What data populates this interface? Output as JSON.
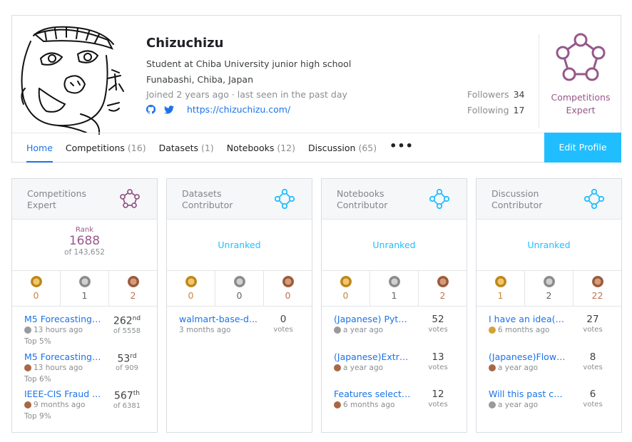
{
  "profile": {
    "name": "Chizuchizu",
    "bio": "Student at Chiba University junior high school",
    "location": "Funabashi, Chiba, Japan",
    "joined": "Joined 2 years ago · last seen in the past day",
    "website": "https://chizuchizu.com/",
    "followers_label": "Followers",
    "followers": "34",
    "following_label": "Following",
    "following": "17",
    "tier_line1": "Competitions",
    "tier_line2": "Expert",
    "icons": [
      "github-icon",
      "twitter-icon"
    ]
  },
  "tabs": [
    {
      "label": "Home",
      "count": ""
    },
    {
      "label": "Competitions",
      "count": "(16)"
    },
    {
      "label": "Datasets",
      "count": "(1)"
    },
    {
      "label": "Notebooks",
      "count": "(12)"
    },
    {
      "label": "Discussion",
      "count": "(65)"
    }
  ],
  "more_label": "•••",
  "edit_profile": "Edit Profile",
  "colors": {
    "accent": "#20beff",
    "expert": "#96588a",
    "link": "#1a73e8"
  },
  "cards": [
    {
      "title": "Competitions Expert",
      "rank_label": "Rank",
      "rank": "1688",
      "rank_of": "of 143,652",
      "medals": {
        "gold": "0",
        "silver": "1",
        "bronze": "2"
      },
      "items": [
        {
          "title": "M5 Forecasting ...",
          "medal": "silver",
          "time": "13 hours ago",
          "top": "Top 5%",
          "rank": "262",
          "suffix": "nd",
          "of": "of 5558"
        },
        {
          "title": "M5 Forecasting ...",
          "medal": "bronze",
          "time": "13 hours ago",
          "top": "Top 6%",
          "rank": "53",
          "suffix": "rd",
          "of": "of 909"
        },
        {
          "title": "IEEE-CIS Fraud ...",
          "medal": "bronze",
          "time": "9 months ago",
          "top": "Top 9%",
          "rank": "567",
          "suffix": "th",
          "of": "of 6381"
        }
      ]
    },
    {
      "title": "Datasets Contributor",
      "unranked": "Unranked",
      "medals": {
        "gold": "0",
        "silver": "0",
        "bronze": "0"
      },
      "items": [
        {
          "title": "walmart-base-d...",
          "medal": "",
          "time": "3 months ago",
          "votes": "0",
          "votes_label": "votes"
        }
      ]
    },
    {
      "title": "Notebooks Contributor",
      "unranked": "Unranked",
      "medals": {
        "gold": "0",
        "silver": "1",
        "bronze": "2"
      },
      "items": [
        {
          "title": "(Japanese) Pyth...",
          "medal": "silver",
          "time": "a year ago",
          "votes": "52",
          "votes_label": "votes"
        },
        {
          "title": "(Japanese)Extra...",
          "medal": "bronze",
          "time": "a year ago",
          "votes": "13",
          "votes_label": "votes"
        },
        {
          "title": "Features selecti...",
          "medal": "bronze",
          "time": "6 months ago",
          "votes": "12",
          "votes_label": "votes"
        }
      ]
    },
    {
      "title": "Discussion Contributor",
      "unranked": "Unranked",
      "medals": {
        "gold": "1",
        "silver": "2",
        "bronze": "22"
      },
      "items": [
        {
          "title": "I have an idea(2...",
          "medal": "gold",
          "time": "6 months ago",
          "votes": "27",
          "votes_label": "votes"
        },
        {
          "title": "(Japanese)Flow ...",
          "medal": "bronze",
          "time": "a year ago",
          "votes": "8",
          "votes_label": "votes"
        },
        {
          "title": "Will this past co...",
          "medal": "silver",
          "time": "a year ago",
          "votes": "6",
          "votes_label": "votes"
        }
      ]
    }
  ]
}
